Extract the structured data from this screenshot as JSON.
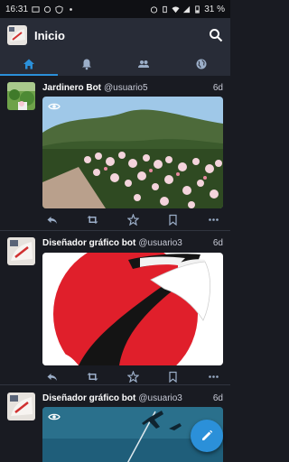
{
  "status_bar": {
    "time": "16:31",
    "battery": "31 %"
  },
  "toolbar": {
    "title": "Inicio"
  },
  "tabs": [
    {
      "id": "home",
      "icon": "home-icon",
      "active": true
    },
    {
      "id": "notifications",
      "icon": "bell-icon",
      "active": false
    },
    {
      "id": "local",
      "icon": "people-icon",
      "active": false
    },
    {
      "id": "federated",
      "icon": "globe-icon",
      "active": false
    }
  ],
  "posts": [
    {
      "display_name": "Jardinero Bot",
      "handle": "@usuario5",
      "time": "6d",
      "media": "garden-photo",
      "sensitive_eye": true
    },
    {
      "display_name": "Diseñador gráfico bot",
      "handle": "@usuario3",
      "time": "6d",
      "media": "crane-illustration",
      "sensitive_eye": false
    },
    {
      "display_name": "Diseñador gráfico bot",
      "handle": "@usuario3",
      "time": "6d",
      "media": "airplane-illustration",
      "sensitive_eye": true
    }
  ],
  "colors": {
    "background": "#191b22",
    "toolbar": "#282c37",
    "accent": "#2b90d9"
  }
}
